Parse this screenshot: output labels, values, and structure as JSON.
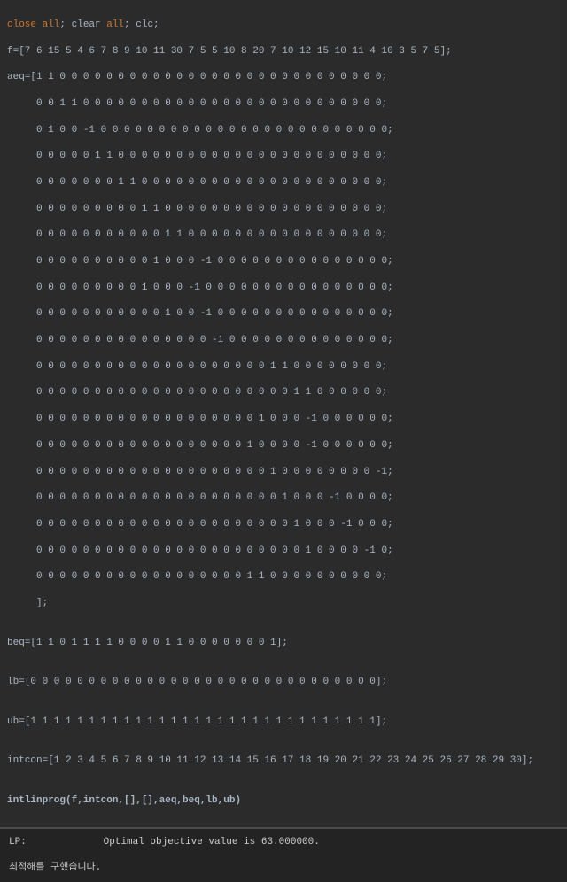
{
  "code": {
    "l1a": "close ",
    "l1b": "all",
    "l1c": "; clear ",
    "l1d": "all",
    "l1e": "; clc;",
    "l2": "f=[7 6 15 5 4 6 7 8 9 10 11 30 7 5 5 10 8 20 7 10 12 15 10 11 4 10 3 5 7 5];",
    "l3": "aeq=[1 1 0 0 0 0 0 0 0 0 0 0 0 0 0 0 0 0 0 0 0 0 0 0 0 0 0 0 0 0;",
    "l4": "     0 0 1 1 0 0 0 0 0 0 0 0 0 0 0 0 0 0 0 0 0 0 0 0 0 0 0 0 0 0;",
    "l5": "     0 1 0 0 -1 0 0 0 0 0 0 0 0 0 0 0 0 0 0 0 0 0 0 0 0 0 0 0 0 0;",
    "l6": "     0 0 0 0 0 1 1 0 0 0 0 0 0 0 0 0 0 0 0 0 0 0 0 0 0 0 0 0 0 0;",
    "l7": "     0 0 0 0 0 0 0 1 1 0 0 0 0 0 0 0 0 0 0 0 0 0 0 0 0 0 0 0 0 0;",
    "l8": "     0 0 0 0 0 0 0 0 0 1 1 0 0 0 0 0 0 0 0 0 0 0 0 0 0 0 0 0 0 0;",
    "l9": "     0 0 0 0 0 0 0 0 0 0 0 1 1 0 0 0 0 0 0 0 0 0 0 0 0 0 0 0 0 0;",
    "l10": "     0 0 0 0 0 0 0 0 0 0 1 0 0 0 -1 0 0 0 0 0 0 0 0 0 0 0 0 0 0 0;",
    "l11": "     0 0 0 0 0 0 0 0 0 1 0 0 0 -1 0 0 0 0 0 0 0 0 0 0 0 0 0 0 0 0;",
    "l12": "     0 0 0 0 0 0 0 0 0 0 0 1 0 0 -1 0 0 0 0 0 0 0 0 0 0 0 0 0 0 0;",
    "l13": "     0 0 0 0 0 0 0 0 0 0 0 0 0 0 0 -1 0 0 0 0 0 0 0 0 0 0 0 0 0 0;",
    "l14": "     0 0 0 0 0 0 0 0 0 0 0 0 0 0 0 0 0 0 0 0 1 1 0 0 0 0 0 0 0 0;",
    "l15": "     0 0 0 0 0 0 0 0 0 0 0 0 0 0 0 0 0 0 0 0 0 0 1 1 0 0 0 0 0 0;",
    "l16": "     0 0 0 0 0 0 0 0 0 0 0 0 0 0 0 0 0 0 0 1 0 0 0 -1 0 0 0 0 0 0;",
    "l17": "     0 0 0 0 0 0 0 0 0 0 0 0 0 0 0 0 0 0 1 0 0 0 0 -1 0 0 0 0 0 0;",
    "l18": "     0 0 0 0 0 0 0 0 0 0 0 0 0 0 0 0 0 0 0 0 1 0 0 0 0 0 0 0 0 -1;",
    "l19": "     0 0 0 0 0 0 0 0 0 0 0 0 0 0 0 0 0 0 0 0 0 1 0 0 0 -1 0 0 0 0;",
    "l20": "     0 0 0 0 0 0 0 0 0 0 0 0 0 0 0 0 0 0 0 0 0 0 1 0 0 0 -1 0 0 0;",
    "l21": "     0 0 0 0 0 0 0 0 0 0 0 0 0 0 0 0 0 0 0 0 0 0 0 1 0 0 0 0 -1 0;",
    "l22": "     0 0 0 0 0 0 0 0 0 0 0 0 0 0 0 0 0 0 1 1 0 0 0 0 0 0 0 0 0 0;",
    "l23": "     ];",
    "blank1": "",
    "l24": "beq=[1 1 0 1 1 1 1 0 0 0 0 1 1 0 0 0 0 0 0 0 1];",
    "blank2": "",
    "l25": "lb=[0 0 0 0 0 0 0 0 0 0 0 0 0 0 0 0 0 0 0 0 0 0 0 0 0 0 0 0 0 0];",
    "blank3": "",
    "l26": "ub=[1 1 1 1 1 1 1 1 1 1 1 1 1 1 1 1 1 1 1 1 1 1 1 1 1 1 1 1 1 1];",
    "blank4": "",
    "l27": "intcon=[1 2 3 4 5 6 7 8 9 10 11 12 13 14 15 16 17 18 19 20 21 22 23 24 25 26 27 28 29 30];",
    "blank5": "",
    "l28": "intlinprog(f,intcon,[],[],aeq,beq,lb,ub)"
  },
  "console": {
    "lp_label": "LP:",
    "lp_msg": "Optimal objective value is 63.000000.",
    "result_msg": "최적해를 구했습니다."
  }
}
